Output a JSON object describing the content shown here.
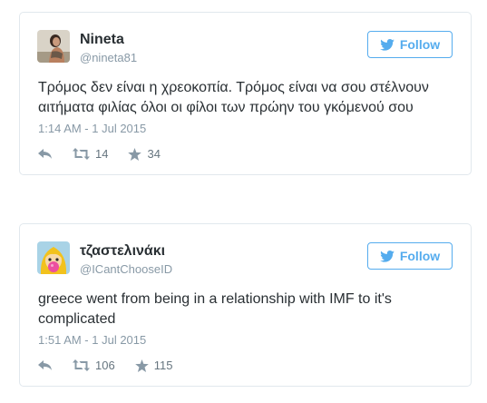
{
  "colors": {
    "accent": "#55acee",
    "card_border": "#e1e8ed",
    "muted_text": "#8899a6",
    "body_text": "#292f33"
  },
  "tweets": [
    {
      "display_name": "Nineta",
      "screen_name": "@nineta81",
      "follow_label": "Follow",
      "text": "Τρόμος δεν είναι η χρεοκοπία. Τρόμος είναι να σου στέλνουν αιτήματα φιλίας όλοι οι φίλοι των πρώην του γκόμενού σου",
      "timestamp": "1:14 AM - 1 Jul 2015",
      "retweets": "14",
      "favorites": "34",
      "icons": {
        "reply": "reply-icon",
        "retweet": "retweet-icon",
        "favorite": "star-icon",
        "follow": "twitter-bird-icon"
      }
    },
    {
      "display_name": "τζαστελινάκι",
      "screen_name": "@ICantChooseID",
      "follow_label": "Follow",
      "text": "greece went from being in a relationship with IMF to it's complicated",
      "timestamp": "1:51 AM - 1 Jul 2015",
      "retweets": "106",
      "favorites": "115",
      "icons": {
        "reply": "reply-icon",
        "retweet": "retweet-icon",
        "favorite": "star-icon",
        "follow": "twitter-bird-icon"
      }
    }
  ]
}
